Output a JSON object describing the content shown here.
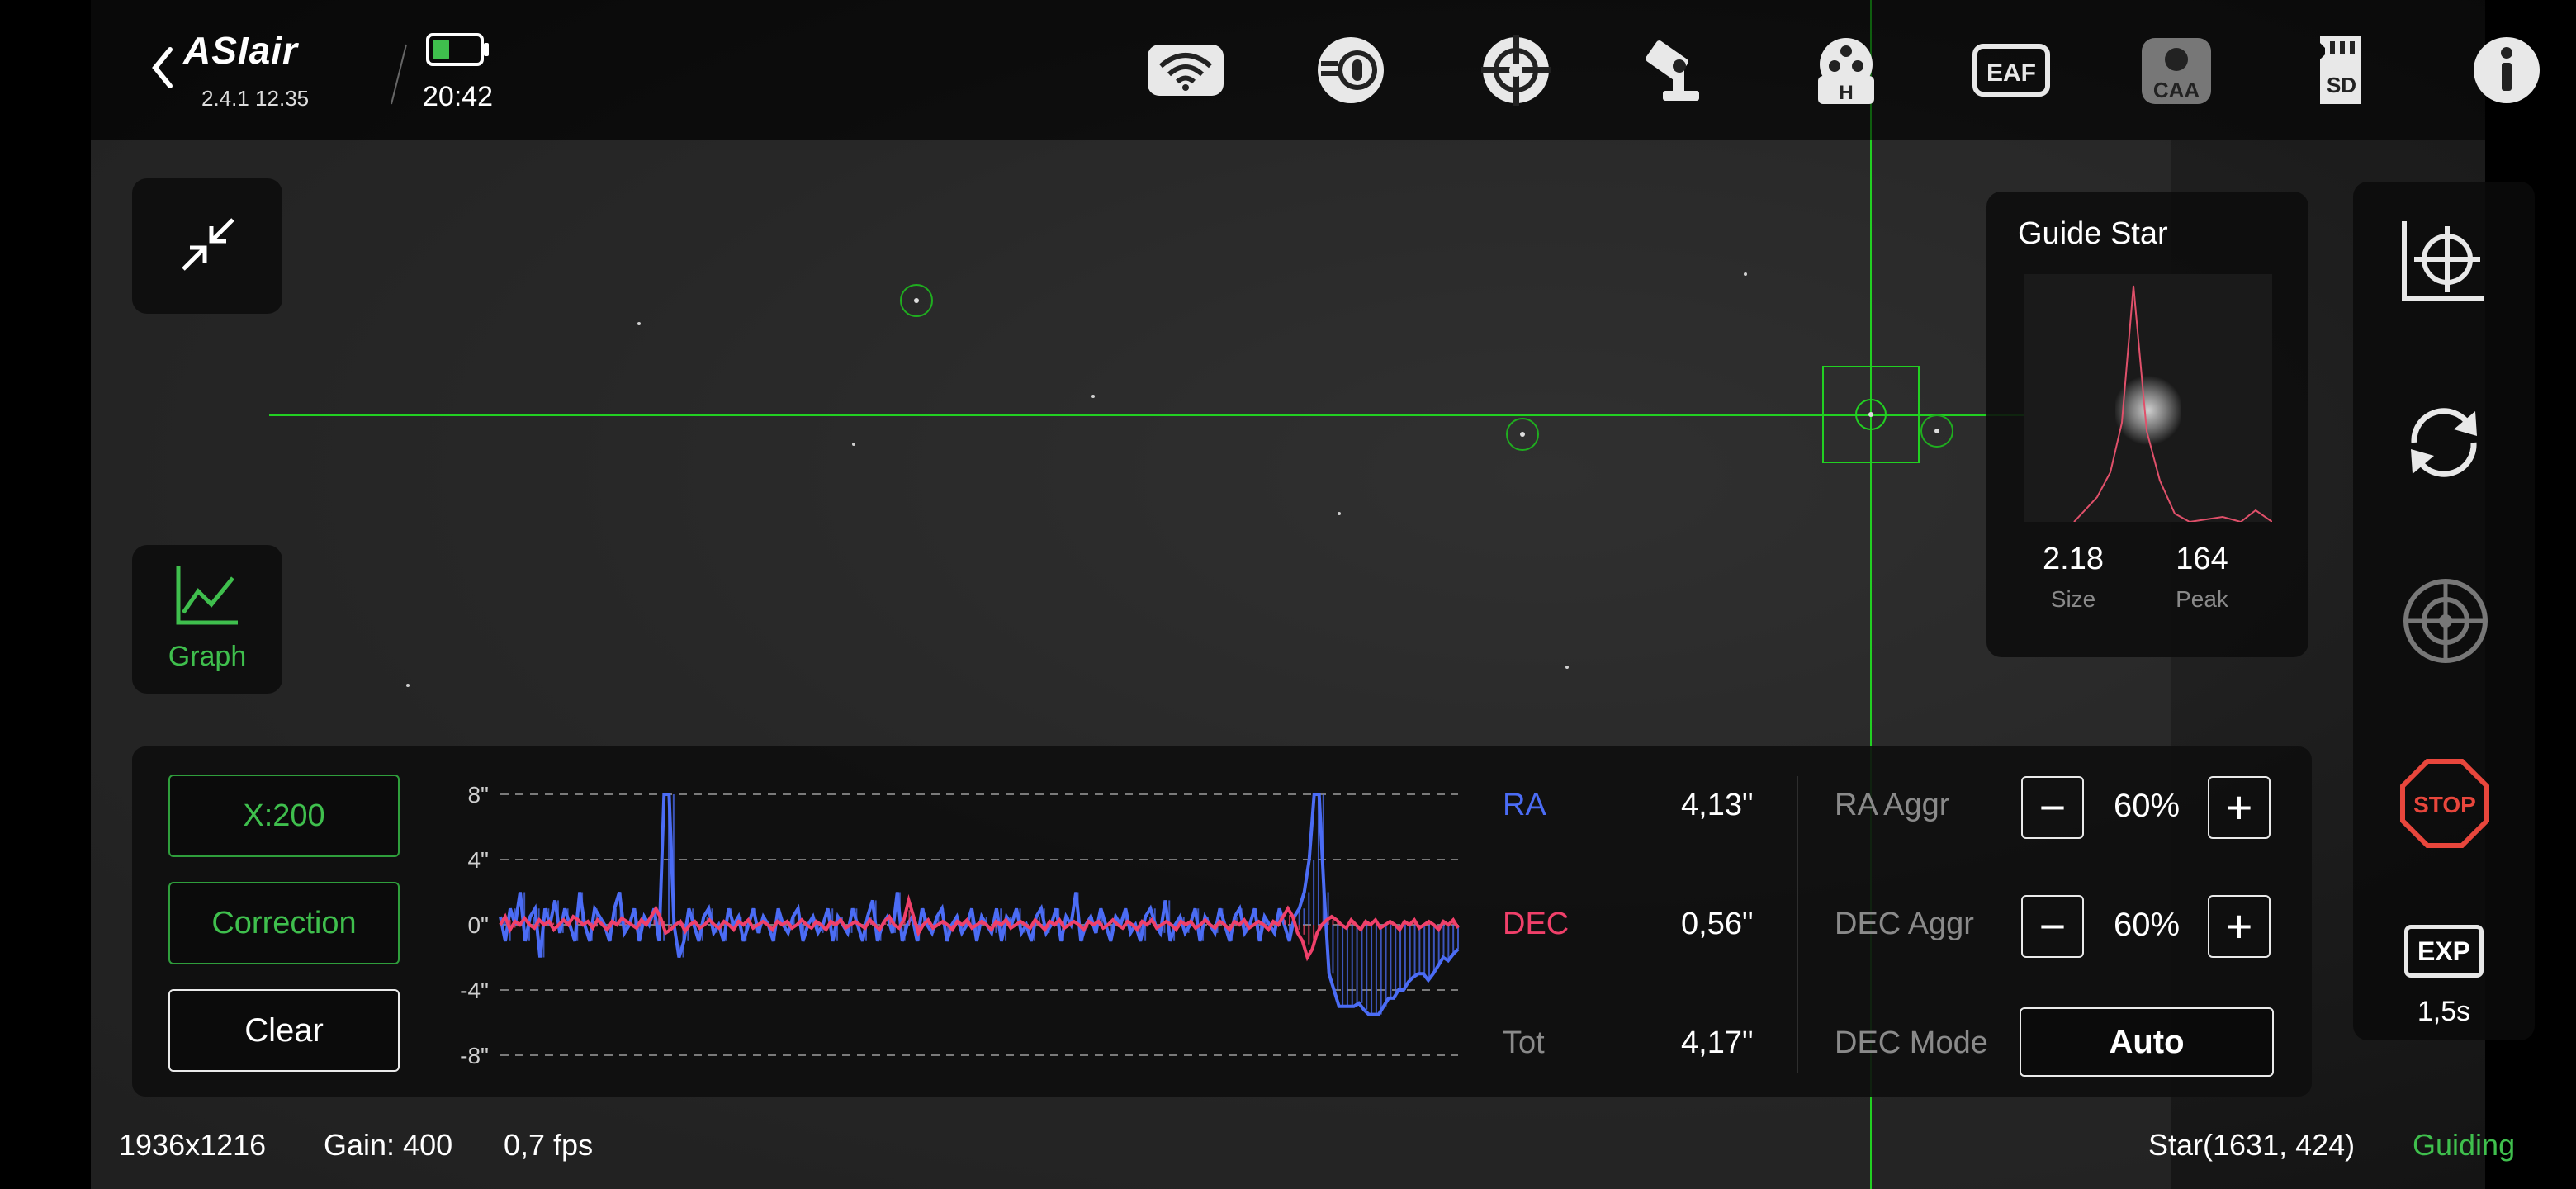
{
  "app": {
    "name": "ASIair",
    "version": "2.4.1 12.35",
    "time": "20:42",
    "battery_level": 0.35
  },
  "top_icons": [
    "wifi-icon",
    "camera-icon",
    "guide-crosshair-icon",
    "telescope-icon",
    "filter-wheel-icon",
    "eaf-icon",
    "caa-icon",
    "sd-card-icon",
    "info-icon"
  ],
  "top_icon_labels": {
    "eaf": "EAF",
    "caa": "CAA",
    "sd": "SD",
    "h": "H"
  },
  "left": {
    "graph_label": "Graph"
  },
  "guide_star": {
    "title": "Guide Star",
    "size_value": "2.18",
    "size_label": "Size",
    "peak_value": "164",
    "peak_label": "Peak"
  },
  "right_toolbar": {
    "stop_label": "STOP",
    "exp_label": "EXP",
    "exp_value": "1,5s"
  },
  "graph_panel": {
    "x_button": "X:200",
    "correction_button": "Correction",
    "clear_button": "Clear",
    "y_ticks": [
      "8\"",
      "4\"",
      "0\"",
      "-4\"",
      "-8\""
    ],
    "ra_label": "RA",
    "ra_value": "4,13\"",
    "dec_label": "DEC",
    "dec_value": "0,56\"",
    "tot_label": "Tot",
    "tot_value": "4,17\"",
    "ra_aggr_label": "RA Aggr",
    "ra_aggr_value": "60%",
    "dec_aggr_label": "DEC Aggr",
    "dec_aggr_value": "60%",
    "dec_mode_label": "DEC Mode",
    "dec_mode_value": "Auto",
    "minus": "−",
    "plus": "+"
  },
  "status_bar": {
    "resolution": "1936x1216",
    "gain": "Gain: 400",
    "fps": "0,7 fps",
    "star_pos": "Star(1631, 424)",
    "state": "Guiding"
  },
  "colors": {
    "accent_green": "#3fbf4d",
    "crosshair_green": "#22d022",
    "ra_blue": "#4b6cf5",
    "dec_red": "#f0406a",
    "stop_red": "#e8463c"
  },
  "chart_data": {
    "type": "line",
    "ylim": [
      -8,
      8
    ],
    "y_tick_labels": [
      "8\"",
      "4\"",
      "0\"",
      "-4\"",
      "-8\""
    ],
    "x_range_points": 200,
    "series": [
      {
        "name": "RA",
        "color": "#4b6cf5",
        "values": [
          0.5,
          -1,
          1,
          0,
          2,
          -1,
          0.5,
          1,
          -2,
          1,
          0,
          1.5,
          -0.5,
          1,
          0,
          -1,
          2,
          0,
          -1,
          1,
          0.5,
          0,
          -1,
          1,
          2,
          -0.5,
          0,
          1,
          -1,
          0.5,
          0,
          1,
          -1,
          8,
          8,
          0,
          -2,
          -1,
          1,
          0,
          -1,
          0.5,
          1,
          -0.5,
          0,
          -1,
          1,
          0,
          0.5,
          -1,
          0,
          1,
          -0.5,
          0.5,
          0,
          -1,
          1,
          0,
          -0.5,
          0.5,
          1,
          -1,
          0,
          0.5,
          -0.5,
          0,
          1,
          -1,
          0.5,
          0,
          -0.5,
          1,
          0,
          -1,
          0.5,
          1.5,
          -1,
          0,
          0.5,
          -0.5,
          2,
          -1,
          0,
          0.5,
          -1,
          1,
          0,
          -0.5,
          0.5,
          1,
          -1,
          0,
          0.5,
          -0.5,
          0,
          1,
          -1,
          0.5,
          0,
          -0.5,
          1,
          -1,
          0.5,
          0,
          1,
          -0.5,
          0,
          -1,
          0.5,
          1,
          -0.5,
          0,
          1,
          -1,
          0.5,
          0,
          2,
          -1,
          0,
          0.5,
          -0.5,
          1,
          0,
          -1,
          0.5,
          0,
          1,
          -0.5,
          0,
          -1,
          0.5,
          1,
          0,
          -0.5,
          1.5,
          -1,
          0,
          0.5,
          -0.5,
          0,
          1,
          -1,
          0.5,
          0,
          -0.5,
          1,
          0,
          -1,
          0.5,
          1,
          -0.5,
          0,
          1,
          -1,
          0.5,
          0,
          -0.5,
          1,
          0,
          -1,
          0.5,
          1,
          2,
          4,
          8,
          8,
          2,
          -3,
          -4,
          -5,
          -5,
          -5,
          -5,
          -4.8,
          -5.2,
          -5.5,
          -5.5,
          -5.5,
          -5,
          -4.5,
          -4.5,
          -4,
          -4,
          -3.5,
          -3.2,
          -3,
          -3,
          -3.4,
          -3,
          -2.5,
          -2,
          -2.2,
          -1.8,
          -1.5
        ]
      },
      {
        "name": "DEC",
        "color": "#f0406a",
        "values": [
          0,
          0.5,
          -0.3,
          0.2,
          0,
          0.4,
          0,
          -0.2,
          0.3,
          0,
          0.2,
          -0.3,
          0,
          0.3,
          0,
          0.5,
          0.3,
          0,
          0.2,
          -0.2,
          0.3,
          0,
          -0.3,
          0.2,
          0,
          0.4,
          0.2,
          0,
          -0.2,
          0.3,
          0,
          0.5,
          1,
          0.4,
          -0.5,
          -0.3,
          0,
          0.2,
          -0.4,
          0,
          0.2,
          -0.2,
          0,
          0.3,
          0,
          -0.2,
          0.2,
          0,
          -0.3,
          0.2,
          0,
          0.3,
          -0.2,
          0,
          0.2,
          0,
          -0.3,
          0.2,
          0,
          0.2,
          -0.2,
          0,
          0.3,
          0,
          -0.2,
          0.2,
          0,
          -0.3,
          0.2,
          0,
          0.3,
          -0.2,
          0,
          0.2,
          0,
          -0.2,
          0.3,
          0,
          -0.3,
          0.2,
          0.5,
          0,
          -0.2,
          0.3,
          1.5,
          0.5,
          -0.5,
          0,
          0.3,
          -0.2,
          0,
          0.2,
          0,
          -0.3,
          0.2,
          0,
          0.3,
          -0.2,
          0,
          0.2,
          0,
          -0.3,
          0.2,
          0,
          0.3,
          -0.2,
          0,
          0.2,
          0,
          -0.2,
          0.3,
          0,
          -0.3,
          0.2,
          0,
          0.3,
          -0.2,
          0,
          0.2,
          0,
          -0.3,
          0.2,
          0,
          0.2,
          -0.2,
          0,
          0.3,
          0,
          -0.2,
          0.2,
          0,
          -0.3,
          0.2,
          0,
          0.3,
          -0.2,
          0,
          0.2,
          0,
          -0.3,
          0.2,
          0,
          0.2,
          -0.2,
          0,
          0.3,
          0,
          -0.2,
          0.2,
          0,
          -0.3,
          0.2,
          0,
          0.3,
          -0.2,
          0,
          0.2,
          0,
          -0.3,
          0.2,
          0,
          0.5,
          1,
          0.5,
          -0.5,
          -1,
          -2,
          -1.5,
          -0.5,
          0,
          0.3,
          0.5,
          0.3,
          0,
          -0.2,
          0.3,
          0,
          -0.3,
          0.2,
          0,
          0.3,
          -0.2,
          0,
          0.2,
          0,
          -0.3,
          0.2,
          0,
          0.3,
          -0.2,
          0,
          0.2,
          0,
          -0.3,
          0.2,
          0,
          0.3,
          -0.2
        ]
      }
    ]
  }
}
